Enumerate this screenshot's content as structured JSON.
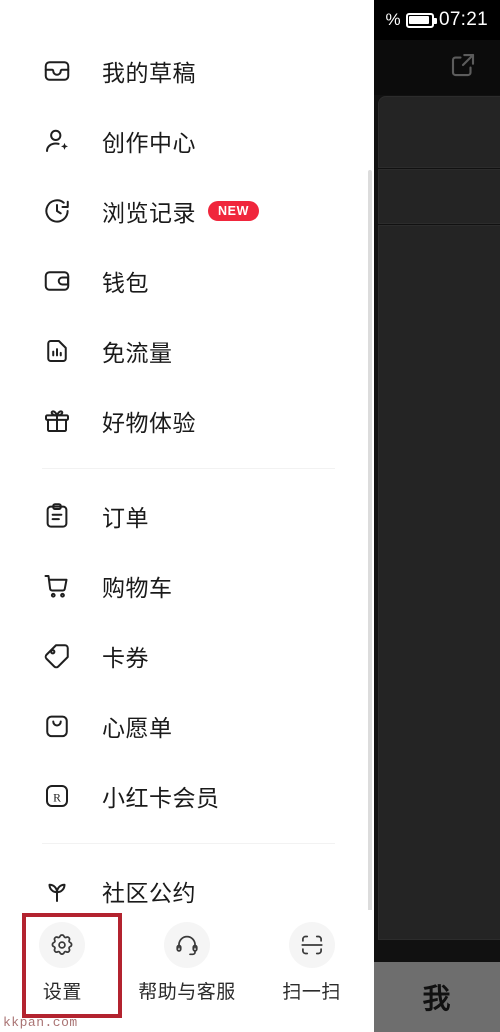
{
  "status_bar": {
    "battery_percent_label": "%",
    "battery_icon": "battery-icon",
    "clock": "07:21"
  },
  "app_behind": {
    "share_icon": "share-external-icon",
    "tab_label": "我"
  },
  "drawer": {
    "scrollbar": "drawer-scrollbar",
    "groups": [
      {
        "items": [
          {
            "icon": "drafts-inbox-icon",
            "label": "我的草稿",
            "badge": null
          },
          {
            "icon": "creator-person-icon",
            "label": "创作中心",
            "badge": null
          },
          {
            "icon": "history-clock-icon",
            "label": "浏览记录",
            "badge": "NEW"
          },
          {
            "icon": "wallet-icon",
            "label": "钱包",
            "badge": null
          },
          {
            "icon": "data-free-sim-icon",
            "label": "免流量",
            "badge": null
          },
          {
            "icon": "gift-box-icon",
            "label": "好物体验",
            "badge": null
          }
        ]
      },
      {
        "items": [
          {
            "icon": "order-clipboard-icon",
            "label": "订单",
            "badge": null
          },
          {
            "icon": "shopping-cart-icon",
            "label": "购物车",
            "badge": null
          },
          {
            "icon": "coupon-tag-icon",
            "label": "卡券",
            "badge": null
          },
          {
            "icon": "wishlist-bag-icon",
            "label": "心愿单",
            "badge": null
          },
          {
            "icon": "redcard-member-icon",
            "label": "小红卡会员",
            "badge": null
          }
        ]
      },
      {
        "items": [
          {
            "icon": "sprout-icon",
            "label": "社区公约",
            "badge": null
          }
        ]
      }
    ]
  },
  "bottom_bar": {
    "actions": [
      {
        "icon": "gear-icon",
        "label": "设置"
      },
      {
        "icon": "headset-icon",
        "label": "帮助与客服"
      },
      {
        "icon": "scan-icon",
        "label": "扫一扫"
      }
    ]
  },
  "annotation": {
    "highlight_color": "#b3232f",
    "target": "设置"
  },
  "watermark": {
    "text": "kkpan.com"
  }
}
